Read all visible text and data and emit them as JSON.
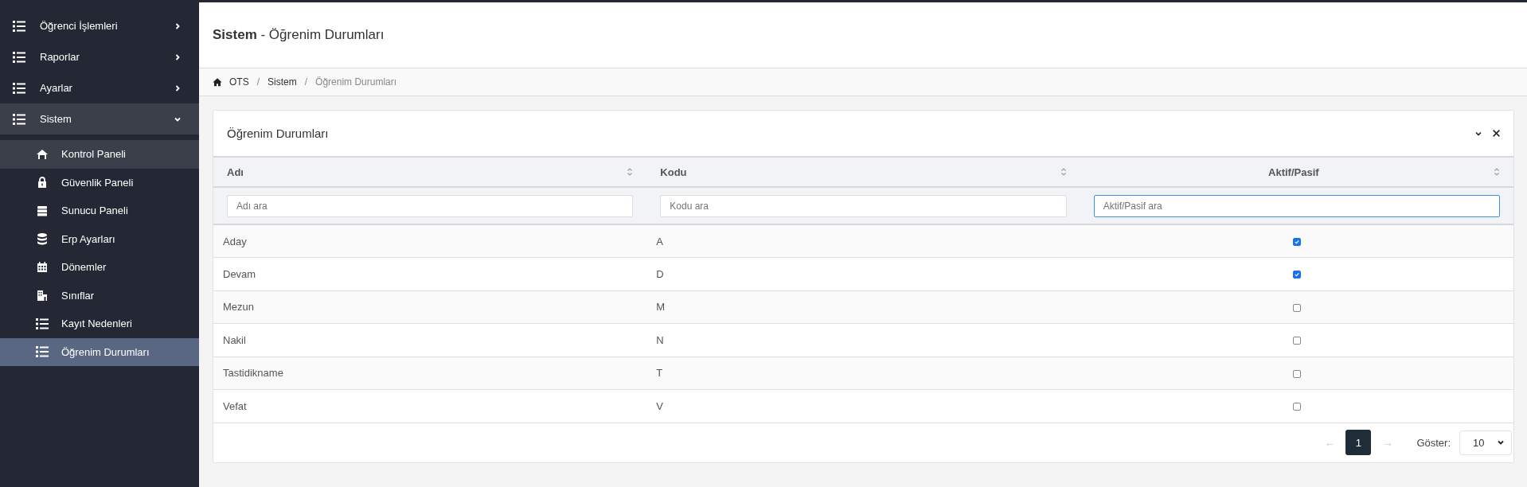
{
  "sidebar": {
    "items": [
      {
        "label": "Öğrenci İşlemleri",
        "expanded": false
      },
      {
        "label": "Raporlar",
        "expanded": false
      },
      {
        "label": "Ayarlar",
        "expanded": false
      },
      {
        "label": "Sistem",
        "expanded": true,
        "children": [
          {
            "label": "Kontrol Paneli",
            "highlighted": true,
            "selected": false
          },
          {
            "label": "Güvenlik Paneli",
            "highlighted": false,
            "selected": false
          },
          {
            "label": "Sunucu Paneli",
            "highlighted": false,
            "selected": false
          },
          {
            "label": "Erp Ayarları",
            "highlighted": false,
            "selected": false
          },
          {
            "label": "Dönemler",
            "highlighted": false,
            "selected": false
          },
          {
            "label": "Sınıflar",
            "highlighted": false,
            "selected": false
          },
          {
            "label": "Kayıt Nedenleri",
            "highlighted": false,
            "selected": false
          },
          {
            "label": "Öğrenim Durumları",
            "highlighted": false,
            "selected": true
          }
        ]
      }
    ]
  },
  "page_title": {
    "section": "Sistem",
    "separator": "-",
    "title": "Öğrenim Durumları"
  },
  "breadcrumb": [
    {
      "label": "OTS",
      "current": false
    },
    {
      "label": "Sistem",
      "current": false
    },
    {
      "label": "Öğrenim Durumları",
      "current": true
    }
  ],
  "breadcrumb_separator": "/",
  "card": {
    "title": "Öğrenim Durumları",
    "table": {
      "columns": [
        {
          "label": "Adı",
          "kind": "text",
          "filter_placeholder": "Adı ara",
          "focused": false
        },
        {
          "label": "Kodu",
          "kind": "text",
          "filter_placeholder": "Kodu ara",
          "focused": false
        },
        {
          "label": "Aktif/Pasif",
          "kind": "checkbox",
          "filter_placeholder": "Aktif/Pasif ara",
          "focused": true
        }
      ],
      "rows": [
        {
          "name": "Aday",
          "code": "A",
          "active": true
        },
        {
          "name": "Devam",
          "code": "D",
          "active": true
        },
        {
          "name": "Mezun",
          "code": "M",
          "active": false
        },
        {
          "name": "Nakil",
          "code": "N",
          "active": false
        },
        {
          "name": "Tastidikname",
          "code": "T",
          "active": false
        },
        {
          "name": "Vefat",
          "code": "V",
          "active": false
        }
      ]
    },
    "pagination": {
      "prev": "←",
      "pages": [
        {
          "label": "1",
          "selected": true
        }
      ],
      "next": "→",
      "show_label": "Göster:",
      "page_size": "10"
    }
  }
}
